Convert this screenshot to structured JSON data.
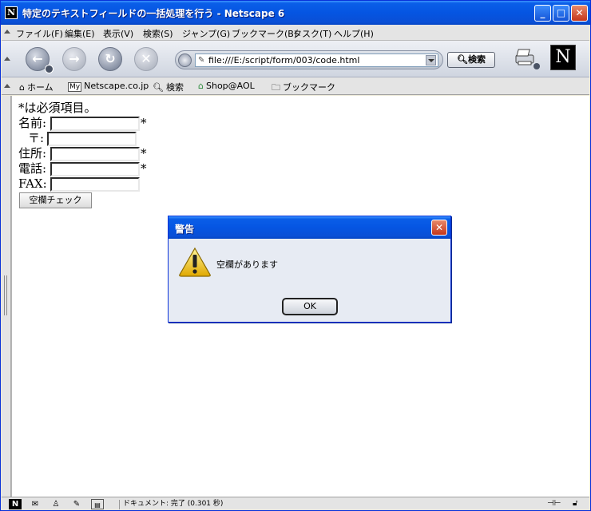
{
  "window": {
    "title": "特定のテキストフィールドの一括処理を行う - Netscape 6",
    "app_icon_letter": "N"
  },
  "menubar": {
    "items": [
      "ファイル(F)",
      "編集(E)",
      "表示(V)",
      "検索(S)",
      "ジャンプ(G)",
      "ブックマーク(B)",
      "タスク(T)",
      "ヘルプ(H)"
    ]
  },
  "navbar": {
    "url": "file:///E:/script/form/003/code.html",
    "search_label": "検索",
    "logo_letter": "N"
  },
  "personal_toolbar": {
    "items": [
      {
        "label": "ホーム",
        "icon": "home-icon"
      },
      {
        "label": "Netscape.co.jp",
        "icon": "my-icon",
        "badge": "My"
      },
      {
        "label": "検索",
        "icon": "search-icon"
      },
      {
        "label": "Shop@AOL",
        "icon": "shop-icon"
      },
      {
        "label": "ブックマーク",
        "icon": "bookmark-folder-icon"
      }
    ]
  },
  "form": {
    "note": "*は必須項目。",
    "fields": [
      {
        "label": "名前:",
        "value": "",
        "required": "*"
      },
      {
        "label": "〒:",
        "value": "",
        "required": ""
      },
      {
        "label": "住所:",
        "value": "",
        "required": "*"
      },
      {
        "label": "電話:",
        "value": "",
        "required": "*"
      },
      {
        "label": "FAX:",
        "value": "",
        "required": ""
      }
    ],
    "check_button": "空欄チェック"
  },
  "dialog": {
    "title": "警告",
    "message": "空欄があります",
    "ok_label": "OK",
    "icon": "warning-icon"
  },
  "statusbar": {
    "text": "ドキュメント: 完了 (0.301 秒)",
    "letter": "N"
  },
  "colors": {
    "titlebar": "#0555e2",
    "close_button": "#c5371b",
    "dialog_body": "#e7ebf3"
  }
}
